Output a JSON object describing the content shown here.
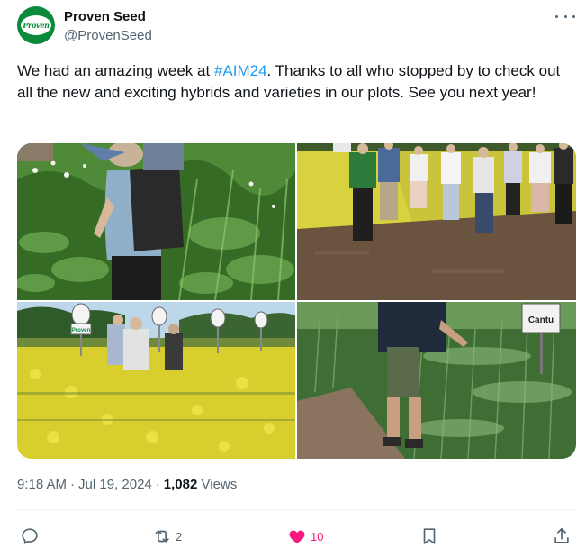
{
  "account": {
    "name": "Proven Seed",
    "handle": "@ProvenSeed",
    "logo_text": "Proven",
    "brand_color": "#0a8a3a"
  },
  "tweet": {
    "text_before": "We had an amazing week at ",
    "hashtag": "#AIM24",
    "text_after": ". Thanks to all who stopped by to check out all the new and exciting hybrids and varieties in our plots. See you next year!",
    "time": "9:18 AM",
    "date": "Jul 19, 2024",
    "views_count": "1,082",
    "views_label": "Views"
  },
  "media": {
    "photos": [
      {
        "subject": "Woman with backpack examining green crop plot"
      },
      {
        "subject": "Group of visitors standing in field beside canola"
      },
      {
        "subject": "Visitors walking through yellow canola plot with Proven signs"
      },
      {
        "subject": "Person walking beside wheat plot with sign"
      }
    ],
    "sign_labels": {
      "proven_sign": "Proven",
      "cantu_sign": "Cantu"
    }
  },
  "actions": {
    "reply": {
      "icon": "reply-icon"
    },
    "retweet": {
      "icon": "retweet-icon",
      "count": "2"
    },
    "like": {
      "icon": "heart-icon",
      "count": "10",
      "color": "#f91880"
    },
    "bookmark": {
      "icon": "bookmark-icon"
    },
    "share": {
      "icon": "share-icon"
    }
  },
  "colors": {
    "text_primary": "#0f1419",
    "text_secondary": "#536471",
    "link": "#1d9bf0",
    "divider": "#eff3f4"
  }
}
